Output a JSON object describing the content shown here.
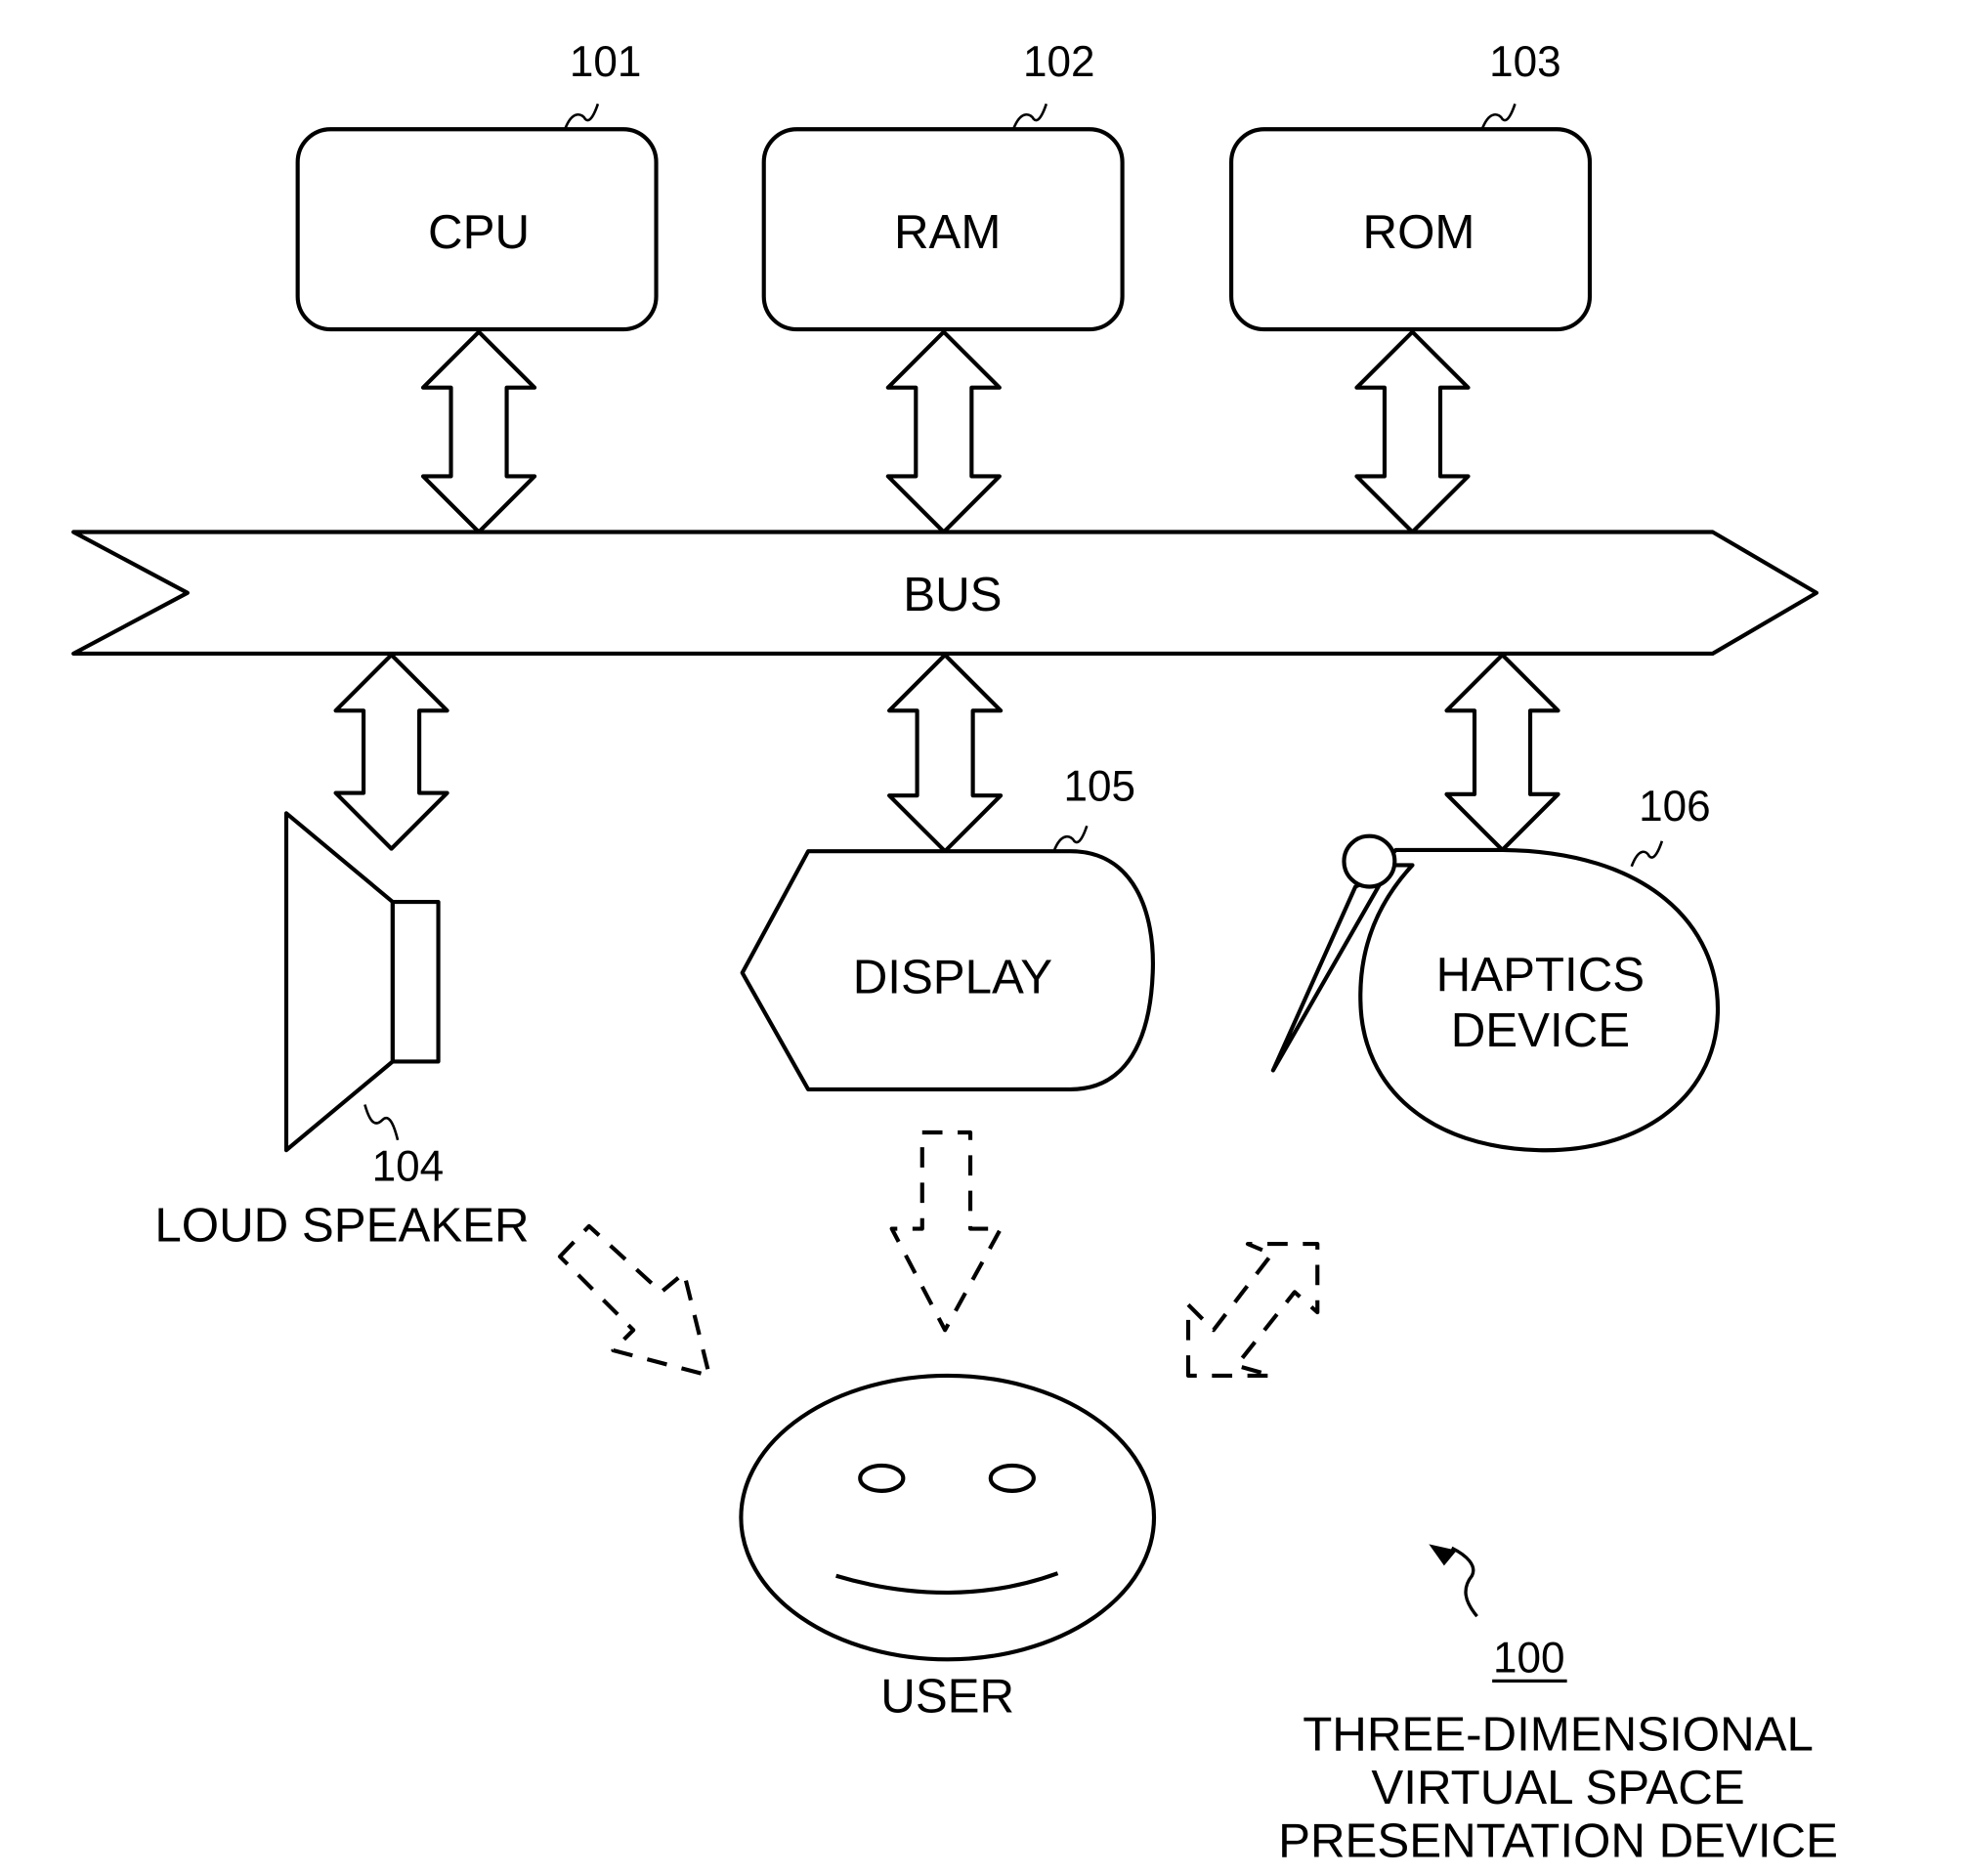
{
  "figure": {
    "components": {
      "cpu": {
        "label": "CPU",
        "ref": "101"
      },
      "ram": {
        "label": "RAM",
        "ref": "102"
      },
      "rom": {
        "label": "ROM",
        "ref": "103"
      },
      "bus": {
        "label": "BUS"
      },
      "speaker": {
        "label": "LOUD SPEAKER",
        "ref": "104"
      },
      "display": {
        "label": "DISPLAY",
        "ref": "105"
      },
      "haptics": {
        "label_line1": "HAPTICS",
        "label_line2": "DEVICE",
        "ref": "106"
      },
      "user": {
        "label": "USER"
      }
    },
    "system": {
      "ref": "100",
      "title_line1": "THREE-DIMENSIONAL",
      "title_line2": "VIRTUAL SPACE",
      "title_line3": "PRESENTATION DEVICE"
    }
  }
}
